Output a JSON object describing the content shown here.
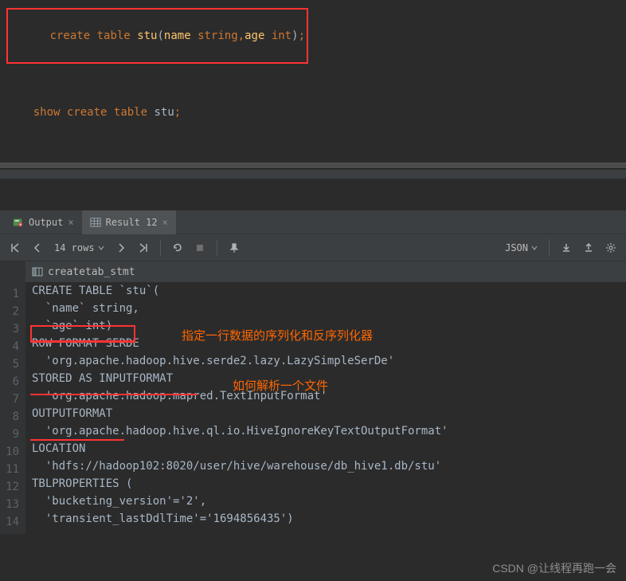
{
  "editor": {
    "line1": {
      "t1": "create",
      "t2": "table",
      "t3": "stu",
      "p1": "(",
      "t4": "name",
      "t5": "string",
      "c1": ",",
      "t6": "age",
      "t7": "int",
      "p2": ")",
      "semi": ";"
    },
    "line2": {
      "t1": "show",
      "t2": "create",
      "t3": "table",
      "t4": "stu",
      "semi": ";"
    }
  },
  "tabs": {
    "output": "Output",
    "result": "Result 12"
  },
  "toolbar": {
    "rows": "14 rows",
    "json": "JSON"
  },
  "header": {
    "col": "createtab_stmt"
  },
  "rows": [
    "CREATE TABLE `stu`(",
    "  `name` string, ",
    "  `age` int)",
    "ROW FORMAT SERDE ",
    "  'org.apache.hadoop.hive.serde2.lazy.LazySimpleSerDe' ",
    "STORED AS INPUTFORMAT ",
    "  'org.apache.hadoop.mapred.TextInputFormat' ",
    "OUTPUTFORMAT ",
    "  'org.apache.hadoop.hive.ql.io.HiveIgnoreKeyTextOutputFormat'",
    "LOCATION",
    "  'hdfs://hadoop102:8020/user/hive/warehouse/db_hive1.db/stu'",
    "TBLPROPERTIES (",
    "  'bucketing_version'='2', ",
    "  'transient_lastDdlTime'='1694856435')"
  ],
  "annotations": {
    "a1": "指定一行数据的序列化和反序列化器",
    "a2": "如何解析一个文件"
  },
  "watermark": "CSDN @让线程再跑一会"
}
